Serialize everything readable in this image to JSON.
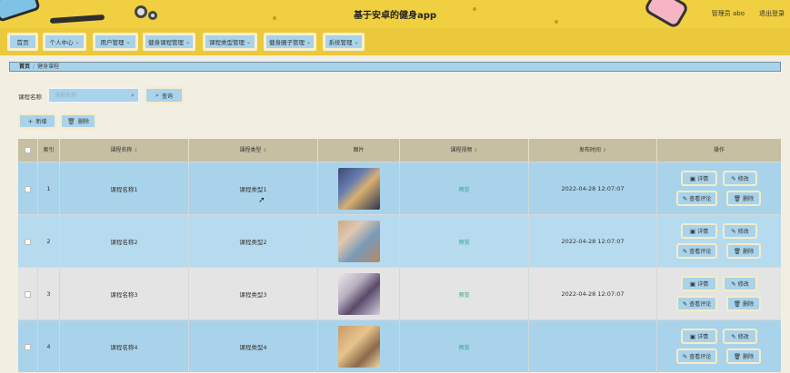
{
  "header": {
    "title": "基于安卓的健身app",
    "admin_label": "管理员 abo",
    "logout_label": "退出登录"
  },
  "nav": {
    "items": [
      {
        "label": "首页",
        "dropdown": false
      },
      {
        "label": "个人中心",
        "dropdown": true
      },
      {
        "label": "用户管理",
        "dropdown": true
      },
      {
        "label": "健身课程管理",
        "dropdown": true
      },
      {
        "label": "课程类型管理",
        "dropdown": true
      },
      {
        "label": "健身圈子管理",
        "dropdown": true
      },
      {
        "label": "系统管理",
        "dropdown": true
      }
    ]
  },
  "breadcrumb": {
    "home": "首页",
    "current": "健身课程"
  },
  "search": {
    "label": "课程名称",
    "placeholder": "课程名称",
    "button_label": "查询"
  },
  "toolbar": {
    "add_label": "新增",
    "delete_label": "删除"
  },
  "table": {
    "columns": [
      "索引",
      "课程名称",
      "课程类型",
      "图片",
      "课程视频",
      "发布时间",
      "操作"
    ],
    "rows": [
      {
        "index": "1",
        "name": "课程名称1",
        "type": "课程类型1",
        "video": "预览",
        "time": "2022-04-28 12:07:07",
        "image": "gym-class-photo-1"
      },
      {
        "index": "2",
        "name": "课程名称2",
        "type": "课程类型2",
        "video": "预览",
        "time": "2022-04-28 12:07:07",
        "image": "gym-class-photo-2"
      },
      {
        "index": "3",
        "name": "课程名称3",
        "type": "课程类型3",
        "video": "预览",
        "time": "2022-04-28 12:07:07",
        "image": "gym-class-photo-3"
      },
      {
        "index": "4",
        "name": "课程名称4",
        "type": "课程类型4",
        "video": "预览",
        "time": "",
        "image": "gym-class-photo-4"
      }
    ],
    "actions": {
      "detail": "详情",
      "edit": "修改",
      "comments": "查看评论",
      "delete": "删除"
    }
  },
  "colors": {
    "header_bg": "#f0d040",
    "nav_bg": "#ebc93c",
    "button_bg": "#a9d3ea",
    "row_blue": "#a9d3ea",
    "row_gray": "#e6e6e6",
    "table_header": "#c6bfa2",
    "link": "#2a9f8a"
  },
  "icons": [
    "chevron-down-icon",
    "search-icon",
    "plus-icon",
    "trash-icon",
    "detail-icon",
    "edit-icon",
    "comment-icon"
  ]
}
